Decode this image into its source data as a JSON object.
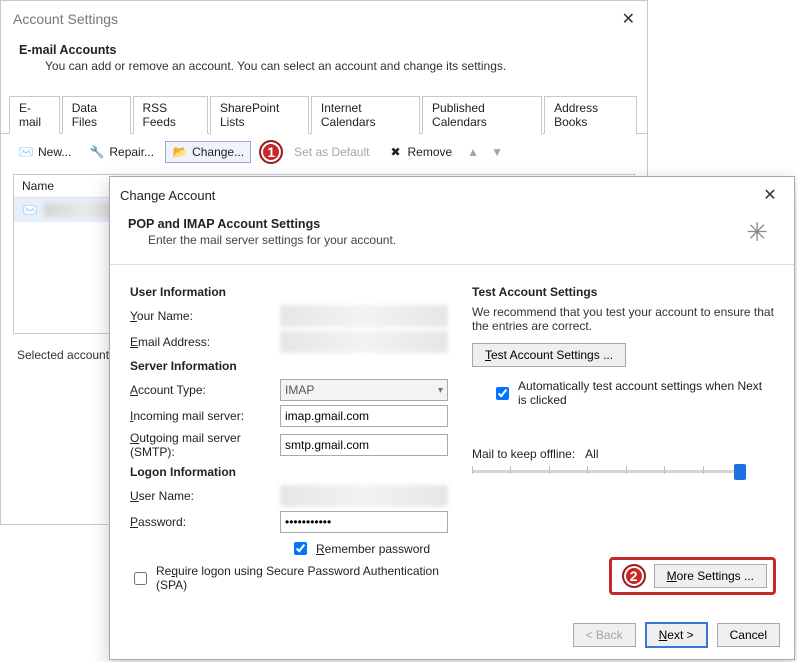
{
  "settings": {
    "title": "Account Settings",
    "close": "✕",
    "head_bold": "E-mail Accounts",
    "head_text": "You can add or remove an account. You can select an account and change its settings.",
    "tabs": [
      "E-mail",
      "Data Files",
      "RSS Feeds",
      "SharePoint Lists",
      "Internet Calendars",
      "Published Calendars",
      "Address Books"
    ],
    "toolbar": {
      "new": "New...",
      "repair": "Repair...",
      "change": "Change...",
      "set_default": "Set as Default",
      "remove": "Remove"
    },
    "acct_header": "Name",
    "selected_text": "Selected account de"
  },
  "callouts": {
    "one": "1",
    "two": "2"
  },
  "dlg": {
    "title": "Change Account",
    "close": "✕",
    "head_bold": "POP and IMAP Account Settings",
    "head_sub": "Enter the mail server settings for your account.",
    "sections": {
      "user": "User Information",
      "server": "Server Information",
      "logon": "Logon Information",
      "test": "Test Account Settings"
    },
    "labels": {
      "your_name": "Your Name:",
      "email": "Email Address:",
      "acct_type": "Account Type:",
      "incoming": "Incoming mail server:",
      "outgoing": "Outgoing mail server (SMTP):",
      "username": "User Name:",
      "password": "Password:",
      "remember": "Remember password",
      "require_spa": "Require logon using Secure Password Authentication (SPA)",
      "mail_offline": "Mail to keep offline:",
      "mail_offline_val": "All"
    },
    "values": {
      "acct_type": "IMAP",
      "incoming": "imap.gmail.com",
      "outgoing": "smtp.gmail.com",
      "password": "***********"
    },
    "right": {
      "desc": "We recommend that you test your account to ensure that the entries are correct.",
      "test_btn": "Test Account Settings ...",
      "auto_test": "Automatically test account settings when Next is clicked"
    },
    "buttons": {
      "more": "More Settings ...",
      "back": "< Back",
      "next": "Next >",
      "cancel": "Cancel"
    }
  }
}
